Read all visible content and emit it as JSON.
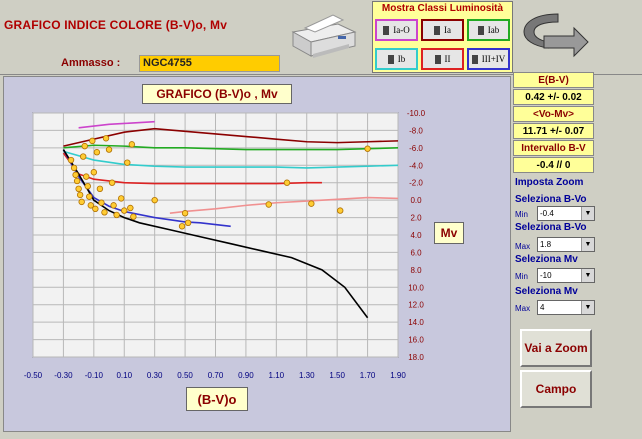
{
  "header": {
    "title": "GRAFICO INDICE COLORE (B-V)o, Mv",
    "ammasso_label": "Ammasso :",
    "ammasso_value": "NGC4755"
  },
  "classes": {
    "title": "Mostra Classi Luminosità",
    "buttons": [
      "Ia-O",
      "Ia",
      "Iab",
      "Ib",
      "II",
      "III+IV"
    ],
    "colors": [
      "#cc44cc",
      "#8b0000",
      "#22aa22",
      "#33cccc",
      "#dd2222",
      "#3333cc"
    ]
  },
  "chart_data": {
    "type": "scatter",
    "title": "GRAFICO (B-V)o , Mv",
    "xlabel": "(B-V)o",
    "ylabel": "Mv",
    "x_ticks": [
      "-0.50",
      "-0.30",
      "-0.10",
      "0.10",
      "0.30",
      "0.50",
      "0.70",
      "0.90",
      "1.10",
      "1.30",
      "1.50",
      "1.70",
      "1.90"
    ],
    "y_ticks": [
      "-10.0",
      "-8.0",
      "-6.0",
      "-4.0",
      "-2.0",
      "0.0",
      "2.0",
      "4.0",
      "6.0",
      "8.0",
      "10.0",
      "12.0",
      "14.0",
      "16.0",
      "18.0"
    ],
    "xlim": [
      -0.5,
      1.9
    ],
    "ylim": [
      -10,
      18
    ],
    "y_reversed": true,
    "grid": true,
    "series": [
      {
        "color": "#cc44cc",
        "x": [
          -0.2,
          -0.1,
          0.0,
          0.1,
          0.3
        ],
        "y": [
          -8.3,
          -8.5,
          -8.7,
          -8.8,
          -9.0
        ]
      },
      {
        "color": "#8b0000",
        "x": [
          -0.3,
          -0.1,
          0.1,
          0.3,
          0.5,
          0.7,
          0.9,
          1.1,
          1.3,
          1.5,
          1.7,
          1.9
        ],
        "y": [
          -6.2,
          -7.0,
          -7.8,
          -8.2,
          -7.9,
          -7.6,
          -7.3,
          -7.0,
          -6.7,
          -6.6,
          -6.7,
          -6.8
        ]
      },
      {
        "color": "#22aa22",
        "x": [
          -0.3,
          -0.1,
          0.1,
          0.3,
          0.5,
          0.7,
          0.9,
          1.1,
          1.3,
          1.5,
          1.7,
          1.9
        ],
        "y": [
          -6.0,
          -6.3,
          -6.2,
          -6.0,
          -6.0,
          -5.9,
          -5.8,
          -5.8,
          -5.8,
          -5.8,
          -5.9,
          -6.0
        ]
      },
      {
        "color": "#33cccc",
        "x": [
          -0.3,
          -0.1,
          0.1,
          0.3,
          0.5,
          0.7,
          0.9,
          1.1,
          1.3,
          1.5,
          1.7,
          1.9
        ],
        "y": [
          -5.6,
          -4.6,
          -4.1,
          -3.9,
          -3.8,
          -3.8,
          -3.8,
          -3.8,
          -3.7,
          -3.8,
          -3.9,
          -4.0
        ]
      },
      {
        "color": "#dd2222",
        "x": [
          -0.3,
          -0.2,
          -0.1,
          0.0,
          0.1,
          0.3,
          0.5,
          0.7,
          0.9,
          1.1,
          1.3,
          1.4
        ],
        "y": [
          -5.4,
          -3.0,
          -2.4,
          -2.2,
          -2.0,
          -1.9,
          -1.9,
          -1.9,
          -1.9,
          -1.9,
          -2.0,
          -2.0
        ]
      },
      {
        "color": "#f09090",
        "x": [
          0.4,
          0.5,
          0.7,
          0.9,
          1.1,
          1.3,
          1.5,
          1.7,
          1.9
        ],
        "y": [
          1.5,
          1.3,
          1.0,
          0.6,
          0.3,
          0.1,
          -0.1,
          -0.3,
          -0.2
        ]
      },
      {
        "color": "#3333cc",
        "x": [
          -0.3,
          -0.2,
          -0.1,
          0.0,
          0.1,
          0.3,
          0.5,
          0.6,
          0.8
        ],
        "y": [
          -5.8,
          -2.7,
          -0.3,
          0.7,
          1.3,
          2.0,
          2.5,
          2.6,
          3.0
        ]
      },
      {
        "color": "#000000",
        "x": [
          -0.3,
          -0.2,
          -0.1,
          0.0,
          0.1,
          0.2,
          0.4,
          0.6,
          0.8,
          1.0,
          1.2,
          1.4,
          1.55,
          1.7
        ],
        "y": [
          -5.8,
          -3.0,
          0.0,
          1.2,
          2.0,
          2.6,
          3.4,
          4.2,
          5.0,
          5.8,
          6.6,
          8.0,
          10.0,
          13.5
        ]
      }
    ],
    "points": [
      {
        "x": -0.25,
        "y": -4.6
      },
      {
        "x": -0.23,
        "y": -3.7
      },
      {
        "x": -0.22,
        "y": -2.9
      },
      {
        "x": -0.21,
        "y": -2.2
      },
      {
        "x": -0.2,
        "y": -1.3
      },
      {
        "x": -0.19,
        "y": -0.6
      },
      {
        "x": -0.18,
        "y": 0.2
      },
      {
        "x": -0.17,
        "y": -5.0
      },
      {
        "x": -0.16,
        "y": -6.2
      },
      {
        "x": -0.15,
        "y": -2.7
      },
      {
        "x": -0.14,
        "y": -1.6
      },
      {
        "x": -0.13,
        "y": -0.4
      },
      {
        "x": -0.12,
        "y": 0.6
      },
      {
        "x": -0.11,
        "y": -6.8
      },
      {
        "x": -0.1,
        "y": -3.2
      },
      {
        "x": -0.09,
        "y": 1.0
      },
      {
        "x": -0.08,
        "y": -5.5
      },
      {
        "x": -0.06,
        "y": -1.3
      },
      {
        "x": -0.05,
        "y": 0.3
      },
      {
        "x": -0.03,
        "y": 1.4
      },
      {
        "x": -0.02,
        "y": -7.1
      },
      {
        "x": 0.0,
        "y": -5.8
      },
      {
        "x": 0.02,
        "y": -2.0
      },
      {
        "x": 0.03,
        "y": 0.6
      },
      {
        "x": 0.05,
        "y": 1.7
      },
      {
        "x": 0.08,
        "y": -0.2
      },
      {
        "x": 0.1,
        "y": 1.2
      },
      {
        "x": 0.12,
        "y": -4.3
      },
      {
        "x": 0.14,
        "y": 0.9
      },
      {
        "x": 0.15,
        "y": -6.4
      },
      {
        "x": 0.16,
        "y": 1.9
      },
      {
        "x": 0.3,
        "y": 0.0
      },
      {
        "x": 0.5,
        "y": 1.5
      },
      {
        "x": 0.52,
        "y": 2.6
      },
      {
        "x": 0.48,
        "y": 3.0
      },
      {
        "x": 1.05,
        "y": 0.5
      },
      {
        "x": 1.17,
        "y": -2.0
      },
      {
        "x": 1.33,
        "y": 0.4
      },
      {
        "x": 1.52,
        "y": 1.2
      },
      {
        "x": 1.7,
        "y": -5.9
      }
    ]
  },
  "results": {
    "ebv_label": "E(B-V)",
    "ebv_value": "0.42 +/- 0.02",
    "vomv_label": "<Vo-Mv>",
    "vomv_value": "11.71 +/- 0.07",
    "intervallo_label": "Intervallo B-V",
    "intervallo_value": "-0.4  //  0"
  },
  "zoom": {
    "title": "Imposta Zoom",
    "sel_bv_label": "Seleziona B-Vo",
    "min_label": "Min",
    "max_label": "Max",
    "bv_min": "-0.4",
    "bv_max": "1.8",
    "sel_mv_label": "Seleziona Mv",
    "mv_min": "-10",
    "mv_max": "4"
  },
  "buttons": {
    "zoom": "Vai a Zoom",
    "campo": "Campo"
  }
}
